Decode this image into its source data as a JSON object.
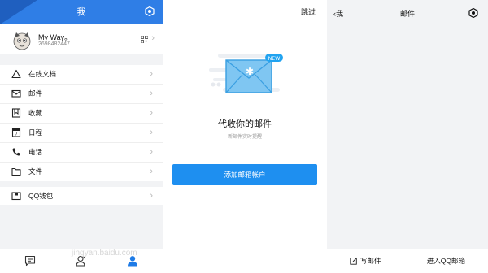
{
  "me": {
    "title": "我",
    "profile": {
      "name": "My Way。",
      "id": "2698482447"
    },
    "menu": [
      {
        "label": "在线文档",
        "icon": "triangle-icon"
      },
      {
        "label": "邮件",
        "icon": "mail-icon"
      },
      {
        "label": "收藏",
        "icon": "bookmark-icon"
      },
      {
        "label": "日程",
        "icon": "calendar-icon"
      },
      {
        "label": "电话",
        "icon": "phone-icon"
      },
      {
        "label": "文件",
        "icon": "folder-icon"
      }
    ],
    "wallet": {
      "label": "QQ钱包",
      "icon": "wallet-icon"
    },
    "tabs": [
      "message-icon",
      "contacts-icon",
      "profile-icon"
    ],
    "colors": {
      "header": "#2f7ee6",
      "active_tab": "#1e7be6"
    }
  },
  "mail_setup": {
    "skip": "跳过",
    "badge": "NEW",
    "title": "代收你的邮件",
    "subtitle": "新邮件实时提醒",
    "add_button": "添加邮箱帐户",
    "colors": {
      "button": "#1e8ff0"
    }
  },
  "mail": {
    "back": "我",
    "title": "邮件",
    "write": "写邮件",
    "enter": "进入QQ邮箱",
    "watermark": "jingyan.baidu.com"
  }
}
